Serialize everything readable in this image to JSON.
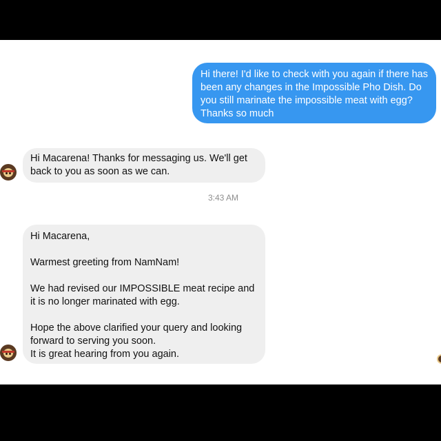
{
  "messages": {
    "outgoing_1": {
      "lines": [
        "Hi there! I'd like to check with you again if there has been any changes in the Impossible Pho Dish. Do you still marinate the impossible meat with egg? Thanks so much"
      ]
    },
    "incoming_1": {
      "text": "Hi Macarena! Thanks for messaging us. We'll get back to you as soon as we can."
    },
    "timestamp": "3:43 AM",
    "incoming_2": {
      "paragraphs": [
        "Hi Macarena,",
        "Warmest greeting from NamNam!",
        "We had revised our IMPOSSIBLE meat recipe and it is no longer marinated with egg.",
        "Hope the above clarified your query and looking forward to serving you soon.\nIt is great hearing from you again."
      ]
    }
  },
  "avatar": {
    "icon": "restaurant-avatar-icon",
    "colors": {
      "background": "#5b3a22",
      "face": "#e9c98a"
    }
  },
  "colors": {
    "outgoing_bubble": "#3797f0",
    "incoming_bubble": "#efefef",
    "timestamp": "#8e8e8e"
  }
}
